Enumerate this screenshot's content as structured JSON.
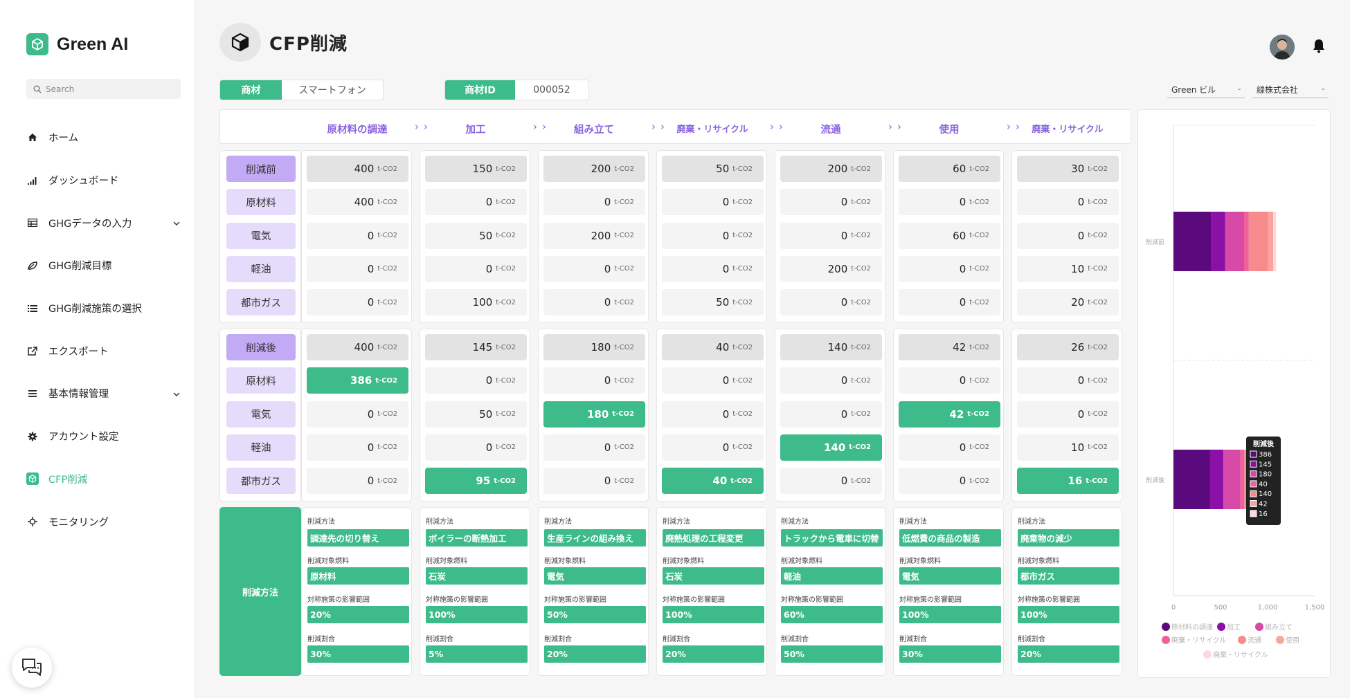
{
  "app": {
    "name": "Green AI"
  },
  "search": {
    "placeholder": "Search"
  },
  "sidebar": {
    "items": [
      {
        "label": "ホーム",
        "icon": "home-icon"
      },
      {
        "label": "ダッシュボード",
        "icon": "signal-bars-icon"
      },
      {
        "label": "GHGデータの入力",
        "icon": "table-icon",
        "expandable": true
      },
      {
        "label": "GHG削減目標",
        "icon": "leaf-icon"
      },
      {
        "label": "GHG削減施策の選択",
        "icon": "list-icon"
      },
      {
        "label": "エクスポート",
        "icon": "external-link-icon"
      },
      {
        "label": "基本情報管理",
        "icon": "menu-icon",
        "expandable": true
      },
      {
        "label": "アカウント設定",
        "icon": "gear-icon"
      },
      {
        "label": "CFP削減",
        "icon": "cube-icon",
        "active": true
      },
      {
        "label": "モニタリング",
        "icon": "crosshair-icon"
      }
    ]
  },
  "page": {
    "title": "CFP削減"
  },
  "filters": {
    "product_key": "商材",
    "product_value": "スマートフォン",
    "product_id_key": "商材ID",
    "product_id_value": "000052",
    "building_select": "Green ビル",
    "company_select": "緑株式会社"
  },
  "stages": [
    "原材料の調達",
    "加工",
    "組み立て",
    "廃棄・リサイクル",
    "流通",
    "使用",
    "廃棄・リサイクル"
  ],
  "unit": "t-CO2",
  "before": {
    "header": "削減前",
    "totals": [
      "400",
      "150",
      "200",
      "50",
      "200",
      "60",
      "30"
    ],
    "rows": [
      {
        "label": "原材料",
        "values": [
          "400",
          "0",
          "0",
          "0",
          "0",
          "0",
          "0"
        ]
      },
      {
        "label": "電気",
        "values": [
          "0",
          "50",
          "200",
          "0",
          "0",
          "60",
          "0"
        ]
      },
      {
        "label": "軽油",
        "values": [
          "0",
          "0",
          "0",
          "0",
          "200",
          "0",
          "10"
        ]
      },
      {
        "label": "都市ガス",
        "values": [
          "0",
          "100",
          "0",
          "50",
          "0",
          "0",
          "20"
        ]
      }
    ]
  },
  "after": {
    "header": "削減後",
    "totals": [
      "400",
      "145",
      "180",
      "40",
      "140",
      "42",
      "26"
    ],
    "rows": [
      {
        "label": "原材料",
        "values": [
          "386",
          "0",
          "0",
          "0",
          "0",
          "0",
          "0"
        ],
        "highlight": [
          true,
          false,
          false,
          false,
          false,
          false,
          false
        ]
      },
      {
        "label": "電気",
        "values": [
          "0",
          "50",
          "180",
          "0",
          "0",
          "42",
          "0"
        ],
        "highlight": [
          false,
          false,
          true,
          false,
          false,
          true,
          false
        ]
      },
      {
        "label": "軽油",
        "values": [
          "0",
          "0",
          "0",
          "0",
          "140",
          "0",
          "10"
        ],
        "highlight": [
          false,
          false,
          false,
          false,
          true,
          false,
          false
        ]
      },
      {
        "label": "都市ガス",
        "values": [
          "0",
          "95",
          "0",
          "40",
          "0",
          "0",
          "16"
        ],
        "highlight": [
          false,
          true,
          false,
          true,
          false,
          false,
          true
        ]
      }
    ]
  },
  "methods": {
    "title": "削減方法",
    "captions": {
      "method": "削減方法",
      "fuel": "削減対象燃料",
      "scope": "対称施策の影響範囲",
      "ratio": "削減割合"
    },
    "columns": [
      {
        "method": "調達先の切り替え",
        "fuel": "原材料",
        "scope": "20%",
        "ratio": "30%"
      },
      {
        "method": "ボイラーの断熱加工",
        "fuel": "石炭",
        "scope": "100%",
        "ratio": "5%"
      },
      {
        "method": "生産ラインの組み換え",
        "fuel": "電気",
        "scope": "50%",
        "ratio": "20%"
      },
      {
        "method": "廃熱処理の工程変更",
        "fuel": "石炭",
        "scope": "100%",
        "ratio": "20%"
      },
      {
        "method": "トラックから電車に切替",
        "fuel": "軽油",
        "scope": "60%",
        "ratio": "50%"
      },
      {
        "method": "低燃費の商品の製造",
        "fuel": "電気",
        "scope": "100%",
        "ratio": "30%"
      },
      {
        "method": "廃棄物の減少",
        "fuel": "都市ガス",
        "scope": "100%",
        "ratio": "20%"
      }
    ]
  },
  "chart_data": {
    "type": "bar",
    "orientation": "horizontal",
    "stacked": true,
    "categories": [
      "削減前",
      "削減後"
    ],
    "series": [
      {
        "name": "原材料の調達",
        "values": [
          400,
          386
        ],
        "color": "#5b0a7e"
      },
      {
        "name": "加工",
        "values": [
          150,
          145
        ],
        "color": "#8b10a8"
      },
      {
        "name": "組み立て",
        "values": [
          200,
          180
        ],
        "color": "#d84aa8"
      },
      {
        "name": "廃棄・リサイクル",
        "values": [
          50,
          40
        ],
        "color": "#f0609a"
      },
      {
        "name": "流通",
        "values": [
          200,
          140
        ],
        "color": "#f78a8a"
      },
      {
        "name": "使用",
        "values": [
          60,
          42
        ],
        "color": "#fba49e"
      },
      {
        "name": "廃棄・リサイクル",
        "values": [
          30,
          26
        ],
        "color": "#fbd9dc"
      }
    ],
    "xlim": [
      0,
      1500
    ],
    "xticks": [
      "0",
      "500",
      "1,000",
      "1,500"
    ],
    "legend_position": "bottom",
    "tooltip": {
      "title": "削減後",
      "values": [
        "386",
        "145",
        "180",
        "40",
        "140",
        "42",
        "16"
      ]
    }
  }
}
